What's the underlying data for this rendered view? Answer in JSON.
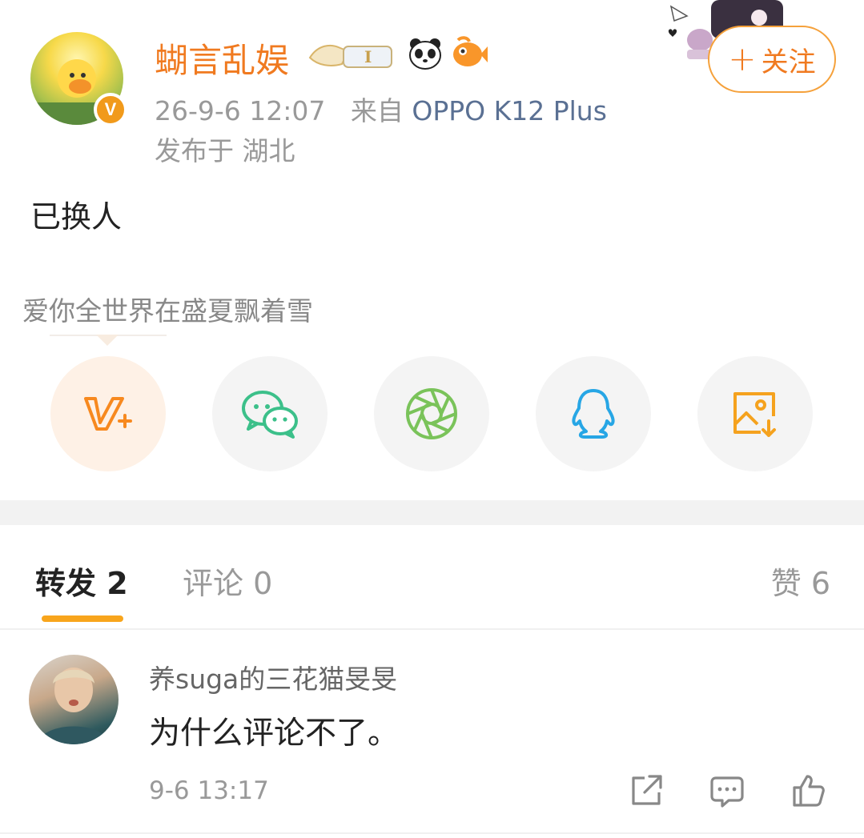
{
  "post": {
    "username": "蝴言乱娱",
    "meta_date": "26-9-6 12:07",
    "meta_from": "来自",
    "meta_device": "OPPO K12 Plus",
    "location": "发布于 湖北",
    "follow_label": "关注",
    "follow_plus": "+",
    "verified_mark": "V",
    "text": "已换人",
    "tagline": "爱你全世界在盛夏飘着雪"
  },
  "share": {
    "items": [
      "weibo-share-icon",
      "wechat-icon",
      "moments-icon",
      "qq-icon",
      "save-image-icon"
    ]
  },
  "tabs": {
    "repost": "转发 2",
    "comment": "评论 0",
    "like": "赞 6"
  },
  "comment": {
    "username": "养suga的三花猫旻旻",
    "text": "为什么评论不了。",
    "time": "9-6 13:17"
  },
  "colors": {
    "accent_orange": "#f07a20",
    "tab_indicator": "#f8a51c",
    "device_link": "#5a7093"
  }
}
